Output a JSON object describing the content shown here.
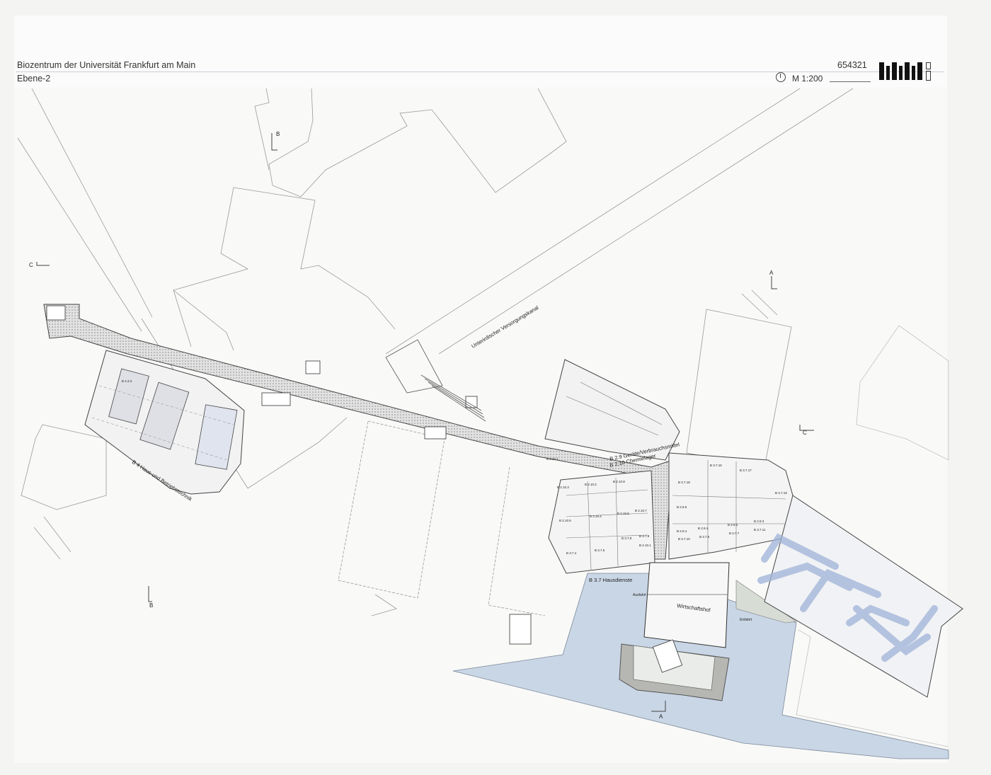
{
  "header": {
    "title": "Biozentrum der Universität Frankfurt am Main",
    "level": "Ebene-2",
    "project_number": "654321",
    "scale": "M 1:200"
  },
  "plan_labels": {
    "canal": "Unterirdischer Versorgungskanal",
    "b4": "B 4 Haus-und Betriebstechnik",
    "b29": "B 2.9 Geräte/Verbrauchsmittel",
    "b210": "B 2.10 Chemielager",
    "b37": "B 3.7 Hausdienste",
    "wirtschaftshof": "Wirtschaftshof",
    "ausfahrt": "Ausfahrt",
    "einfahrt": "Einfahrt",
    "section_a_top": "A",
    "section_a_bottom": "A",
    "section_b_top": "B",
    "section_b_bottom": "B",
    "section_c_left": "C",
    "section_c_right": "C"
  },
  "room_labels": [
    "B 4.3.3",
    "B 2.10.1",
    "B 2.10.3",
    "B 2.10.2",
    "B 2.10.8",
    "B 2.10.5",
    "B 2.10.4",
    "B 2.10.6",
    "B 2.10.7",
    "B 3.7.8",
    "B 3.7.9",
    "B 2.10.1",
    "B 3.7.4",
    "B 3.7.5",
    "B 3.7.18",
    "B 3.7.16",
    "B 3.7.17",
    "B 2.9.5",
    "B 2.9.4",
    "B 2.9.1",
    "B 2.9.2",
    "B 2.9.3",
    "B 3.7.6",
    "B 3.7.7",
    "B 3.7.10",
    "B 3.7.11",
    "B 3.7.19"
  ]
}
